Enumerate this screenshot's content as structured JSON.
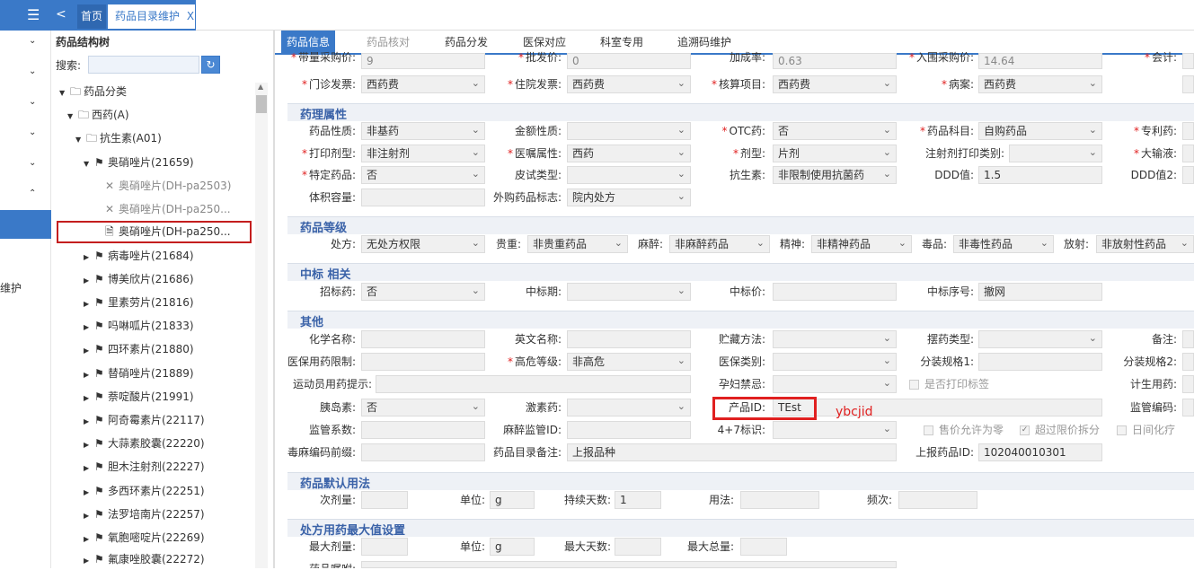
{
  "topbar": {
    "home_tab": "首页",
    "active_tab": "药品目录维护",
    "close_glyph": "X"
  },
  "leftnav": {
    "item_label": "维护"
  },
  "tree": {
    "title": "药品结构树",
    "search_label": "搜索:",
    "search_value": "",
    "nodes": [
      {
        "label": "药品分类"
      },
      {
        "label": "西药(A)"
      },
      {
        "label": "抗生素(A01)"
      },
      {
        "label": "奥硝唑片(21659)"
      },
      {
        "label": "奥硝唑片(DH-pa2503)"
      },
      {
        "label": "奥硝唑片(DH-pa250..."
      },
      {
        "label": "奥硝唑片(DH-pa250..."
      },
      {
        "label": "病毒唑片(21684)"
      },
      {
        "label": "博美欣片(21686)"
      },
      {
        "label": "里素劳片(21816)"
      },
      {
        "label": "吗啉呱片(21833)"
      },
      {
        "label": "四环素片(21880)"
      },
      {
        "label": "替硝唑片(21889)"
      },
      {
        "label": "萘啶酸片(21991)"
      },
      {
        "label": "阿奇霉素片(22117)"
      },
      {
        "label": "大蒜素胶囊(22220)"
      },
      {
        "label": "胆木注射剂(22227)"
      },
      {
        "label": "多西环素片(22251)"
      },
      {
        "label": "法罗培南片(22257)"
      },
      {
        "label": "氧胞嘧啶片(22269)"
      },
      {
        "label": "氟康唑胶囊(22272)"
      }
    ]
  },
  "tabs": [
    "药品信息",
    "药品核对",
    "药品分发",
    "医保对应",
    "科室专用",
    "追溯码维护"
  ],
  "sections": {
    "s1": "药理属性",
    "s2": "药品等级",
    "s3": "中标 相关",
    "s4": "其他",
    "s5": "药品默认用法",
    "s6": "处方用药最大值设置"
  },
  "fields": {
    "r0": {
      "l1": "带量采购价:",
      "v1": "9",
      "l2": "批发价:",
      "v2": "0",
      "l3": "加成率:",
      "v3": "0.63",
      "l4": "入围采购价:",
      "v4": "14.64",
      "l5": "会计:"
    },
    "r1": {
      "l1": "门诊发票:",
      "v1": "西药费",
      "l2": "住院发票:",
      "v2": "西药费",
      "l3": "核算项目:",
      "v3": "西药费",
      "l4": "病案:",
      "v4": "西药费"
    },
    "p1": {
      "l1": "药品性质:",
      "v1": "非基药",
      "l2": "金额性质:",
      "v2": "",
      "l3": "OTC药:",
      "v3": "否",
      "l4": "药品科目:",
      "v4": "自购药品",
      "l5": "专利药:"
    },
    "p2": {
      "l1": "打印剂型:",
      "v1": "非注射剂",
      "l2": "医嘱属性:",
      "v2": "西药",
      "l3": "剂型:",
      "v3": "片剂",
      "l4": "注射剂打印类别:",
      "v4": "",
      "l5": "大输液:"
    },
    "p3": {
      "l1": "特定药品:",
      "v1": "否",
      "l2": "皮试类型:",
      "v2": "",
      "l3": "抗生素:",
      "v3": "非限制使用抗菌药",
      "l4": "DDD值:",
      "v4": "1.5",
      "l5": "DDD值2:"
    },
    "p4": {
      "l1": "体积容量:",
      "v1": "",
      "l2": "外购药品标志:",
      "v2": "院内处方"
    },
    "g1": {
      "l1": "处方:",
      "v1": "无处方权限",
      "l2": "贵重:",
      "v2": "非贵重药品",
      "l3": "麻醉:",
      "v3": "非麻醉药品",
      "l4": "精神:",
      "v4": "非精神药品",
      "l5": "毒品:",
      "v5": "非毒性药品",
      "l6": "放射:",
      "v6": "非放射性药品"
    },
    "z1": {
      "l1": "招标药:",
      "v1": "否",
      "l2": "中标期:",
      "v2": "",
      "l3": "中标价:",
      "v3": "",
      "l4": "中标序号:",
      "v4": "撤网"
    },
    "o1": {
      "l1": "化学名称:",
      "l2": "英文名称:",
      "l3": "贮藏方法:",
      "l4": "摆药类型:",
      "l5": "备注:"
    },
    "o2": {
      "l1": "医保用药限制:",
      "l2": "高危等级:",
      "v2": "非高危",
      "l3": "医保类别:",
      "l4": "分装规格1:",
      "l5": "分装规格2:"
    },
    "o3": {
      "l1": "运动员用药提示:",
      "l3": "孕妇禁忌:",
      "chk": "是否打印标签",
      "l5": "计生用药:"
    },
    "o4": {
      "l1": "胰岛素:",
      "v1": "否",
      "l2": "激素药:",
      "l3": "产品ID:",
      "v3": "TEst",
      "l5": "监管编码:"
    },
    "o5": {
      "l1": "监管系数:",
      "l2": "麻醉监管ID:",
      "l3": "4+7标识:",
      "c1": "售价允许为零",
      "c2": "超过限价拆分",
      "c3": "日间化疗"
    },
    "o6": {
      "l1": "毒麻编码前缀:",
      "l2": "药品目录备注:",
      "v2": "上报品种",
      "l3": "上报药品ID:",
      "v3": "102040010301"
    },
    "d1": {
      "l1": "次剂量:",
      "l2": "单位:",
      "v2": "g",
      "l3": "持续天数:",
      "v3": "1",
      "l4": "用法:",
      "l5": "频次:"
    },
    "m1": {
      "l1": "最大剂量:",
      "l2": "单位:",
      "v2": "g",
      "l3": "最大天数:",
      "l4": "最大总量:"
    },
    "m2": {
      "l1": "药品嘱咐:"
    }
  },
  "annotation": "ybcjid",
  "colors": {
    "accent": "#3a79c8",
    "highlight": "#e02020"
  }
}
